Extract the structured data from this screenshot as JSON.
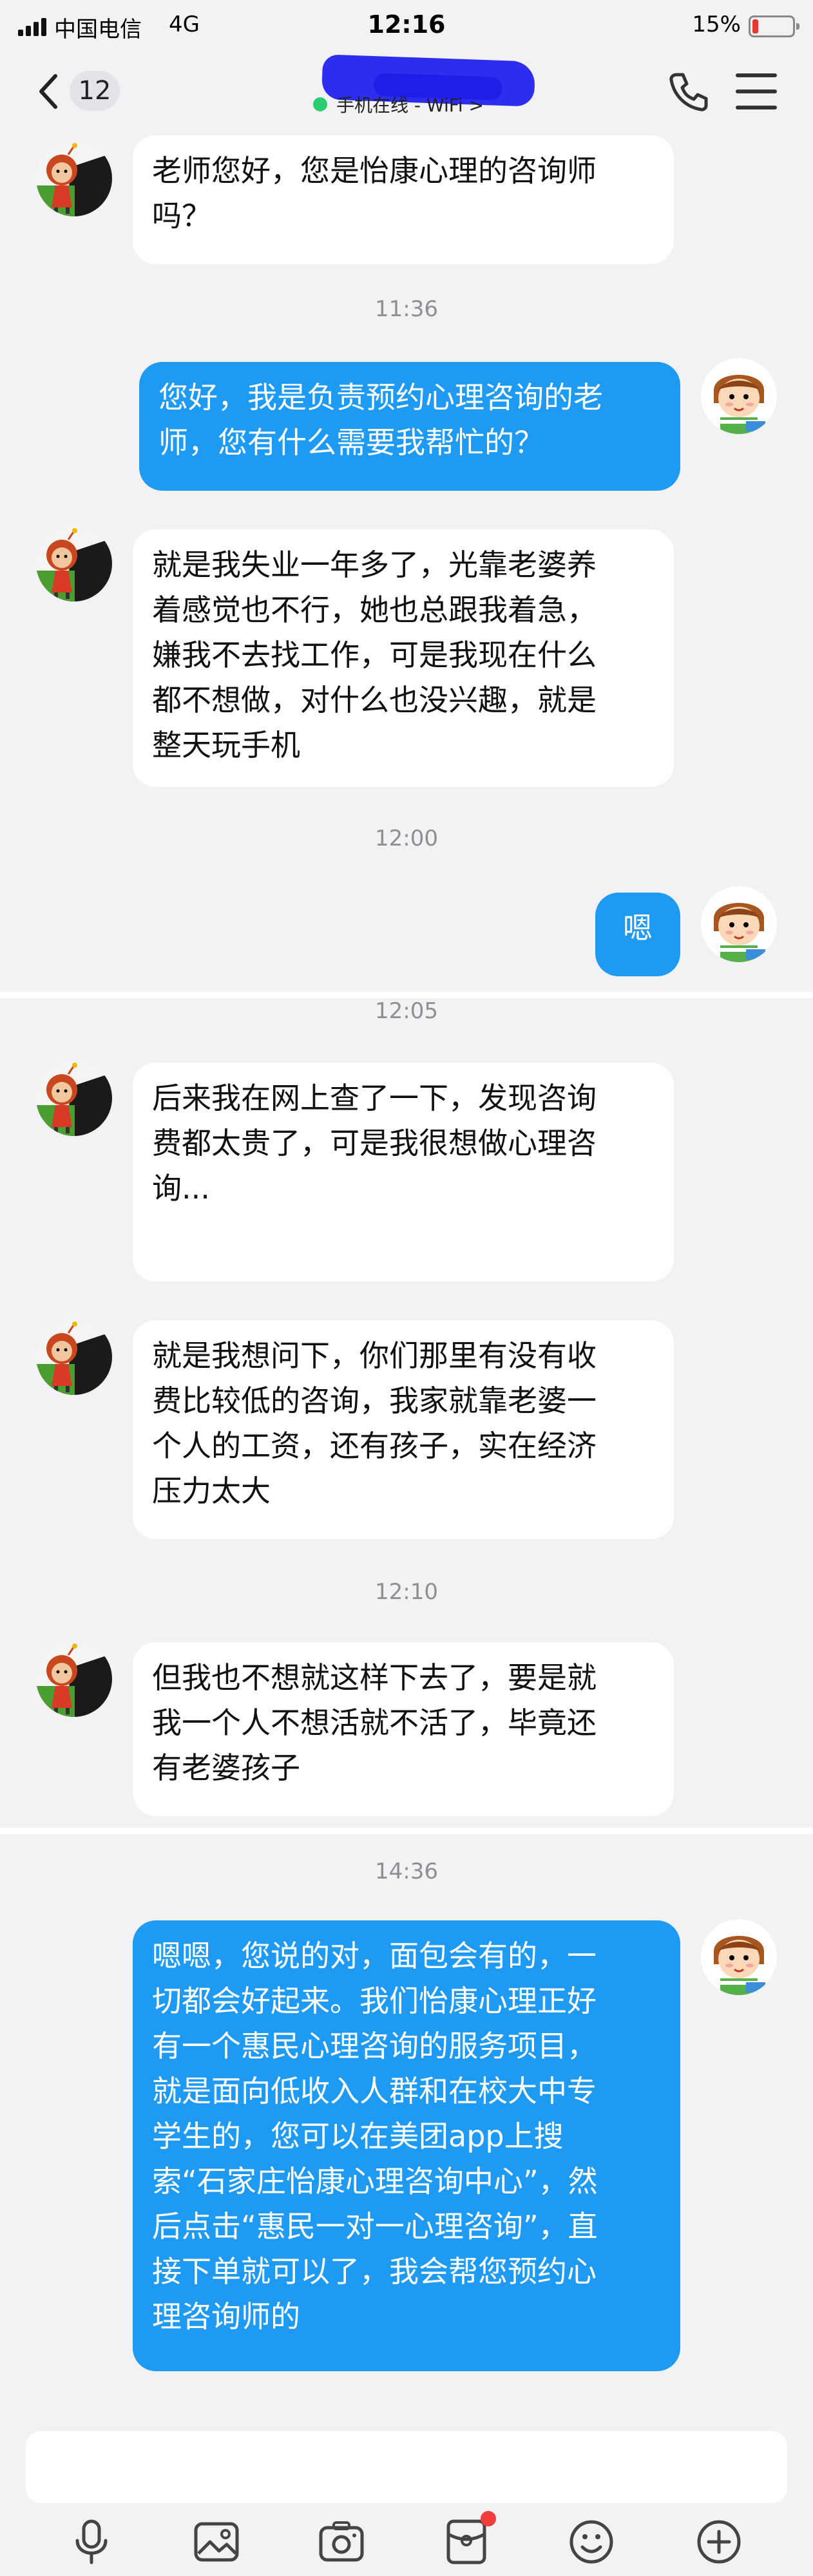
{
  "status_bar": {
    "carrier": "中国电信",
    "network": "4G",
    "time": "12:16",
    "battery": "15%",
    "battery_level": 0.15
  },
  "header": {
    "unread_count": "12",
    "contact_status": "手机在线 - WiFi >",
    "status_color": "#2ecc71"
  },
  "colors": {
    "outgoing_bubble": "#1e9af3",
    "incoming_bubble": "#ffffff",
    "background": "#f2f2f4"
  },
  "messages": [
    {
      "type": "in",
      "text": "老师您好，您是怡康心理的咨询师\n吗？"
    },
    {
      "type": "time",
      "text": "11:36"
    },
    {
      "type": "out",
      "text": "您好，我是负责预约心理咨询的老\n师，您有什么需要我帮忙的？"
    },
    {
      "type": "in",
      "text": "就是我失业一年多了，光靠老婆养\n着感觉也不行，她也总跟我着急，\n嫌我不去找工作，可是我现在什么\n都不想做，对什么也没兴趣，就是\n整天玩手机"
    },
    {
      "type": "time",
      "text": "12:00"
    },
    {
      "type": "out",
      "text": "嗯"
    },
    {
      "type": "time",
      "text": "12:05"
    },
    {
      "type": "in",
      "text": "后来我在网上查了一下，发现咨询\n费都太贵了，可是我很想做心理咨\n询..."
    },
    {
      "type": "in",
      "text": "就是我想问下，你们那里有没有收\n费比较低的咨询，我家就靠老婆一\n个人的工资，还有孩子，实在经济\n压力太大"
    },
    {
      "type": "time",
      "text": "12:10"
    },
    {
      "type": "in",
      "text": "但我也不想就这样下去了，要是就\n我一个人不想活就不活了，毕竟还\n有老婆孩子"
    },
    {
      "type": "time",
      "text": "14:36"
    },
    {
      "type": "out",
      "text": "嗯嗯，您说的对，面包会有的，一\n切都会好起来。我们怡康心理正好\n有一个惠民心理咨询的服务项目，\n就是面向低收入人群和在校大中专\n学生的，您可以在美团app上搜\n索“石家庄怡康心理咨询中心”，然\n后点击“惠民一对一心理咨询”，直\n接下单就可以了，我会帮您预约心\n理咨询师的"
    }
  ],
  "toolbar": {
    "icons": [
      "microphone-icon",
      "image-icon",
      "camera-icon",
      "red-packet-icon",
      "emoji-icon",
      "plus-icon"
    ]
  }
}
